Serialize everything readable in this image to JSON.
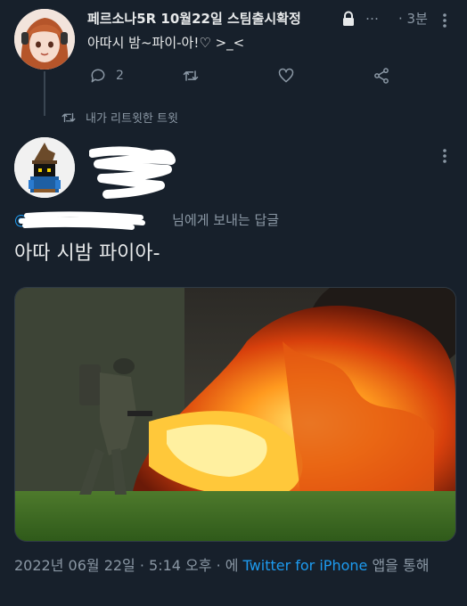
{
  "parent_tweet": {
    "display_name": "페르소나5R 10월22일 스팀출시확정",
    "more_inline": "…",
    "time": "3분",
    "text": "아따시 밤~파이-아!♡ >_<",
    "reply_count": "2",
    "icons": [
      "lock-icon",
      "reply-icon",
      "retweet-icon",
      "like-icon",
      "share-icon",
      "more-icon"
    ]
  },
  "retweet_label": "내가 리트윗한 트윗",
  "main_tweet": {
    "replying_suffix": "님에게 보내는 답글",
    "text": "아따 시밤 파이아-",
    "meta_prefix": "2022년 06월 22일 · 5:14 오후 · 에 ",
    "meta_source": "Twitter for iPhone",
    "meta_suffix": " 앱을 통해"
  },
  "colors": {
    "background": "#17202b",
    "text": "#e7e9ea",
    "secondary": "#8b98a5",
    "accent": "#1d9bf0"
  }
}
